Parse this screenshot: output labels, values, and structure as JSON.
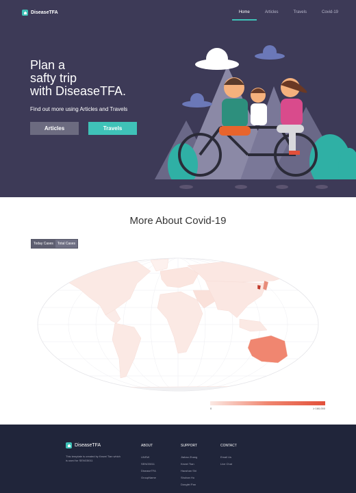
{
  "brand": {
    "name": "DiseaseTFA"
  },
  "nav": {
    "items": [
      {
        "label": "Home"
      },
      {
        "label": "Articles"
      },
      {
        "label": "Travels"
      },
      {
        "label": "Covid-19"
      }
    ]
  },
  "hero": {
    "title_lines": [
      "Plan a",
      "safty trip",
      "with DiseaseTFA."
    ],
    "subtitle": "Find out more using Articles and Travels",
    "articles_button": "Articles",
    "travels_button": "Travels"
  },
  "covid": {
    "title": "More About Covid-19",
    "toggle": [
      "Today Cases",
      "Total Cases"
    ],
    "legend_min": "0",
    "legend_max": "≥ 160,000"
  },
  "footer": {
    "brand": "DiseaseTFA",
    "description": "This template is created by Kewei Tian which is used for SENG5011",
    "columns": [
      {
        "title": "ABOUT",
        "links": [
          "UNSW",
          "SENG5011",
          "DiseaseTFA",
          "GroupName"
        ]
      },
      {
        "title": "SUPPORT",
        "links": [
          "Jiahao Zhang",
          "Kewei Tian",
          "Haoshan Shi",
          "Shuhan Hu",
          "Dongfei Pan"
        ]
      },
      {
        "title": "CONTACT",
        "links": [
          "Email Us",
          "Live Chat"
        ]
      }
    ]
  },
  "colors": {
    "hero_bg": "#3d3a57",
    "accent": "#3fc2b8",
    "footer_bg": "#20253a",
    "map_high": "#e2503a"
  }
}
